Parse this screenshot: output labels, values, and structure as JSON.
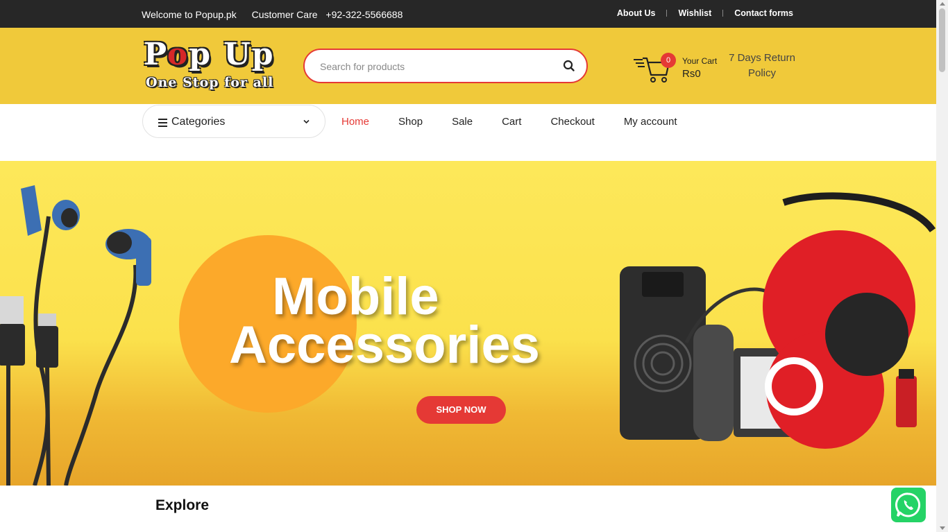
{
  "topbar": {
    "welcome": "Welcome to Popup.pk",
    "care_label": "Customer Care",
    "phone": "+92-322-5566688",
    "links": [
      "About Us",
      "Wishlist",
      "Contact forms"
    ]
  },
  "logo": {
    "line1_a": "P",
    "line1_o": "o",
    "line1_b": "p Up",
    "line2": "One Stop for all"
  },
  "search": {
    "placeholder": "Search for products"
  },
  "cart": {
    "count": "0",
    "label": "Your Cart",
    "amount": "Rs0"
  },
  "return_policy": {
    "line1": "7 Days Return",
    "line2": "Policy"
  },
  "categories": {
    "label": "Categories"
  },
  "nav": {
    "items": [
      "Home",
      "Shop",
      "Sale",
      "Cart",
      "Checkout",
      "My account"
    ],
    "active": "Home"
  },
  "hero": {
    "line1": "Mobile",
    "line2": "Accessories",
    "button": "SHOP NOW"
  },
  "section": {
    "title": "Explore"
  },
  "colors": {
    "topbar": "#272727",
    "header": "#f0c93a",
    "accent": "#e53935",
    "hero_yellow": "#fde85a",
    "hero_orange": "#fca92a",
    "whatsapp": "#25d366"
  },
  "icons": [
    "search-icon",
    "cart-icon",
    "menu-icon",
    "chevron-down-icon",
    "whatsapp-icon"
  ]
}
